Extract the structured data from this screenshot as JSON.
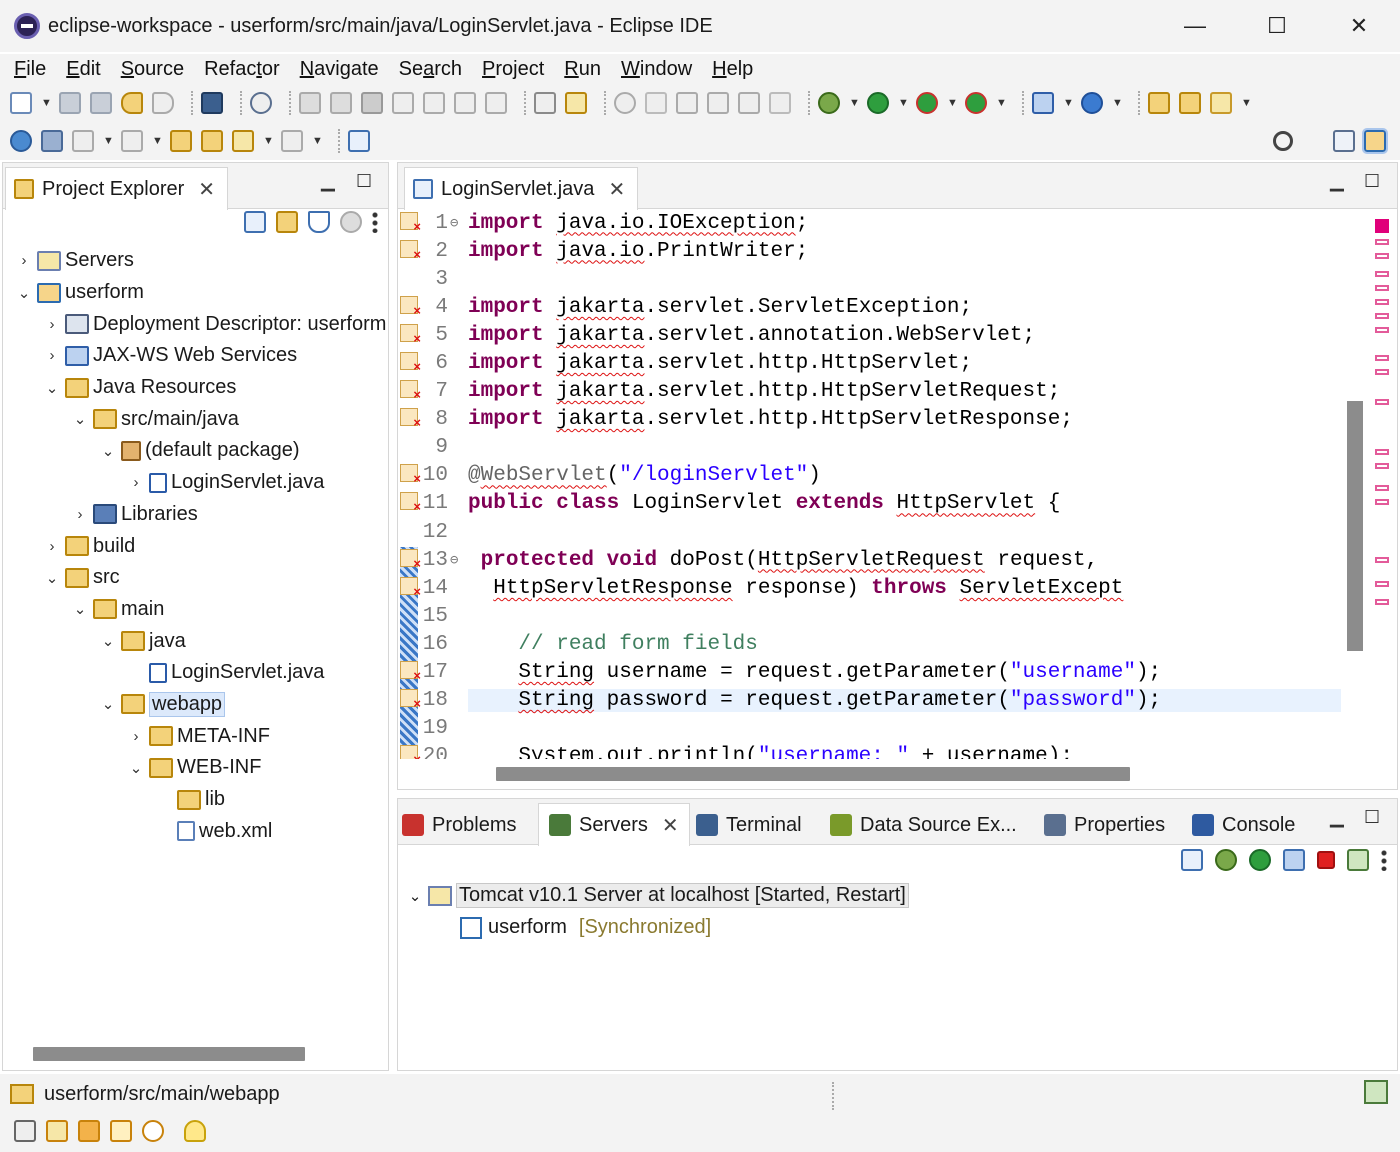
{
  "window": {
    "title": "eclipse-workspace - userform/src/main/java/LoginServlet.java - Eclipse IDE",
    "minimize": "—",
    "maximize": "☐",
    "close": "✕"
  },
  "menu": [
    {
      "pre": "",
      "u": "F",
      "post": "ile"
    },
    {
      "pre": "",
      "u": "E",
      "post": "dit"
    },
    {
      "pre": "",
      "u": "S",
      "post": "ource"
    },
    {
      "pre": "Refac",
      "u": "t",
      "post": "or"
    },
    {
      "pre": "",
      "u": "N",
      "post": "avigate"
    },
    {
      "pre": "Se",
      "u": "a",
      "post": "rch"
    },
    {
      "pre": "",
      "u": "P",
      "post": "roject"
    },
    {
      "pre": "",
      "u": "R",
      "post": "un"
    },
    {
      "pre": "",
      "u": "W",
      "post": "indow"
    },
    {
      "pre": "",
      "u": "H",
      "post": "elp"
    }
  ],
  "project_explorer": {
    "title": "Project Explorer",
    "close": "✕",
    "tree": [
      {
        "label": "Servers",
        "depth": 0,
        "chev": "›",
        "icon": "server"
      },
      {
        "label": "userform",
        "depth": 0,
        "chev": "⌄",
        "icon": "project"
      },
      {
        "label": "Deployment Descriptor: userform",
        "depth": 1,
        "chev": "›",
        "icon": "dd"
      },
      {
        "label": "JAX-WS Web Services",
        "depth": 1,
        "chev": "›",
        "icon": "ws"
      },
      {
        "label": "Java Resources",
        "depth": 1,
        "chev": "⌄",
        "icon": "folder"
      },
      {
        "label": "src/main/java",
        "depth": 2,
        "chev": "⌄",
        "icon": "folder"
      },
      {
        "label": "(default package)",
        "depth": 3,
        "chev": "⌄",
        "icon": "pkg"
      },
      {
        "label": "LoginServlet.java",
        "depth": 4,
        "chev": "›",
        "icon": "java"
      },
      {
        "label": "Libraries",
        "depth": 2,
        "chev": "›",
        "icon": "lib"
      },
      {
        "label": "build",
        "depth": 1,
        "chev": "›",
        "icon": "folder"
      },
      {
        "label": "src",
        "depth": 1,
        "chev": "⌄",
        "icon": "folder"
      },
      {
        "label": "main",
        "depth": 2,
        "chev": "⌄",
        "icon": "folder"
      },
      {
        "label": "java",
        "depth": 3,
        "chev": "⌄",
        "icon": "folder"
      },
      {
        "label": "LoginServlet.java",
        "depth": 4,
        "chev": "",
        "icon": "java"
      },
      {
        "label": "webapp",
        "depth": 3,
        "chev": "⌄",
        "icon": "folder",
        "selected": true
      },
      {
        "label": "META-INF",
        "depth": 4,
        "chev": "›",
        "icon": "folder"
      },
      {
        "label": "WEB-INF",
        "depth": 4,
        "chev": "⌄",
        "icon": "folder"
      },
      {
        "label": "lib",
        "depth": 5,
        "chev": "",
        "icon": "folder"
      },
      {
        "label": "web.xml",
        "depth": 5,
        "chev": "",
        "icon": "xml"
      }
    ]
  },
  "editor": {
    "tab_label": "LoginServlet.java",
    "close": "✕",
    "lines": [
      {
        "n": "1",
        "fold": "⊖",
        "err": true,
        "tokens": [
          [
            "kw",
            "import"
          ],
          [
            "",
            "",
            " "
          ],
          [
            "sq",
            "java.io.IOException"
          ],
          [
            "",
            ";"
          ]
        ]
      },
      {
        "n": "2",
        "err": true,
        "tokens": [
          [
            "kw",
            "import"
          ],
          [
            "",
            " "
          ],
          [
            "sq",
            "java.io"
          ],
          [
            "",
            ".PrintWriter;"
          ]
        ]
      },
      {
        "n": "3",
        "tokens": []
      },
      {
        "n": "4",
        "err": true,
        "tokens": [
          [
            "kw",
            "import"
          ],
          [
            "",
            " "
          ],
          [
            "sq",
            "jakarta"
          ],
          [
            "",
            ".servlet.ServletException;"
          ]
        ]
      },
      {
        "n": "5",
        "err": true,
        "tokens": [
          [
            "kw",
            "import"
          ],
          [
            "",
            " "
          ],
          [
            "sq",
            "jakarta"
          ],
          [
            "",
            ".servlet.annotation.WebServlet;"
          ]
        ]
      },
      {
        "n": "6",
        "err": true,
        "tokens": [
          [
            "kw",
            "import"
          ],
          [
            "",
            " "
          ],
          [
            "sq",
            "jakarta"
          ],
          [
            "",
            ".servlet.http.HttpServlet;"
          ]
        ]
      },
      {
        "n": "7",
        "err": true,
        "tokens": [
          [
            "kw",
            "import"
          ],
          [
            "",
            " "
          ],
          [
            "sq",
            "jakarta"
          ],
          [
            "",
            ".servlet.http.HttpServletRequest;"
          ]
        ]
      },
      {
        "n": "8",
        "err": true,
        "tokens": [
          [
            "kw",
            "import"
          ],
          [
            "",
            " "
          ],
          [
            "sq",
            "jakarta"
          ],
          [
            "",
            ".servlet.http.HttpServletResponse;"
          ]
        ]
      },
      {
        "n": "9",
        "tokens": []
      },
      {
        "n": "10",
        "err": true,
        "tokens": [
          [
            "ann",
            "@"
          ],
          [
            "ann sq",
            "WebServlet"
          ],
          [
            "",
            "("
          ],
          [
            "str",
            "\"/loginServlet\""
          ],
          [
            "",
            ")"
          ]
        ]
      },
      {
        "n": "11",
        "err": true,
        "tokens": [
          [
            "kw",
            "public"
          ],
          [
            "",
            " "
          ],
          [
            "kw",
            "class"
          ],
          [
            "",
            " LoginServlet "
          ],
          [
            "kw",
            "extends"
          ],
          [
            "",
            " "
          ],
          [
            "sq",
            "HttpServlet"
          ],
          [
            "",
            " {"
          ]
        ]
      },
      {
        "n": "12",
        "tokens": []
      },
      {
        "n": "13",
        "fold": "⊖",
        "err": true,
        "tokens": [
          [
            "",
            " "
          ],
          [
            "kw",
            "protected"
          ],
          [
            "",
            " "
          ],
          [
            "kw",
            "void"
          ],
          [
            "",
            " doPost("
          ],
          [
            "sq",
            "HttpServletRequest"
          ],
          [
            "",
            " request,"
          ]
        ]
      },
      {
        "n": "14",
        "err": true,
        "tokens": [
          [
            "",
            "  "
          ],
          [
            "sq",
            "HttpServletResponse"
          ],
          [
            "",
            " response) "
          ],
          [
            "kw",
            "throws"
          ],
          [
            "",
            " "
          ],
          [
            "sq",
            "ServletExcept"
          ]
        ]
      },
      {
        "n": "15",
        "tokens": []
      },
      {
        "n": "16",
        "tokens": [
          [
            "",
            "    "
          ],
          [
            "com",
            "// read form fields"
          ]
        ]
      },
      {
        "n": "17",
        "err": true,
        "tokens": [
          [
            "",
            "    "
          ],
          [
            "sq",
            "String"
          ],
          [
            "",
            " username = request.getParameter("
          ],
          [
            "str",
            "\"username\""
          ],
          [
            "",
            ");"
          ]
        ]
      },
      {
        "n": "18",
        "err": true,
        "current": true,
        "tokens": [
          [
            "",
            "    "
          ],
          [
            "sq",
            "String"
          ],
          [
            "",
            " password = request.getParameter("
          ],
          [
            "str",
            "\"password\""
          ],
          [
            "",
            ");"
          ]
        ]
      },
      {
        "n": "19",
        "tokens": []
      },
      {
        "n": "20",
        "err": true,
        "tokens": [
          [
            "",
            "    System.out.println("
          ],
          [
            "str",
            "\"username: \""
          ],
          [
            "",
            " + username);"
          ]
        ]
      }
    ]
  },
  "bottom": {
    "tabs": [
      {
        "label": "Problems",
        "icon": "problems-icon",
        "color": "#c8322e"
      },
      {
        "label": "Servers",
        "icon": "servers-icon",
        "color": "#4a7a3a",
        "active": true
      },
      {
        "label": "Terminal",
        "icon": "terminal-icon",
        "color": "#3b5f8e"
      },
      {
        "label": "Data Source Ex...",
        "icon": "data-source-icon",
        "color": "#7a9a2a"
      },
      {
        "label": "Properties",
        "icon": "properties-icon",
        "color": "#5a6f8f"
      },
      {
        "label": "Console",
        "icon": "console-icon",
        "color": "#2e5aa0"
      }
    ],
    "close": "✕",
    "servers": {
      "server": "Tomcat v10.1 Server at localhost  [Started, Restart]",
      "module": "userform",
      "module_status": "[Synchronized]"
    }
  },
  "status": {
    "path": "userform/src/main/webapp"
  },
  "colors": {
    "keyword": "#7f0055",
    "string": "#2a00ff",
    "comment": "#3f7f5f",
    "error": "#dd1111",
    "selection": "#dce9fb"
  }
}
